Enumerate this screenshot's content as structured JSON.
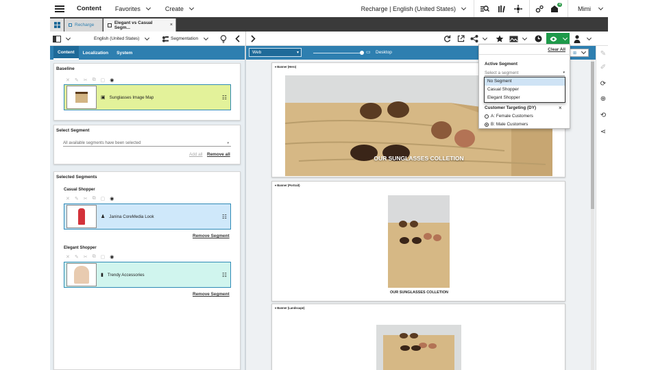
{
  "topbar": {
    "app_title": "Content",
    "favorites": "Favorites",
    "create": "Create",
    "site": "Recharge | English (United States)",
    "user": "Mimi",
    "notifications": "4"
  },
  "tabs": [
    {
      "label": "Recharge"
    },
    {
      "label": "Elegant vs Casual Segm..."
    }
  ],
  "toolbar": {
    "locale": "English (United States)",
    "segmentation": "Segmentation"
  },
  "left_panel": {
    "tabs": [
      "Content",
      "Localization",
      "System"
    ],
    "baseline": {
      "heading": "Baseline",
      "item": "Sunglasses Image Map"
    },
    "select_segment": {
      "heading": "Select Segment",
      "value": "All available segments have been selected",
      "add_all": "Add all",
      "remove_all": "Remove all"
    },
    "selected_segments": {
      "heading": "Selected Segments",
      "segments": [
        {
          "name": "Casual Shopper",
          "item": "Janina CoreMedia Look",
          "remove": "Remove Segment"
        },
        {
          "name": "Elegant Shopper",
          "item": "Trendy Accessories",
          "remove": "Remove Segment"
        }
      ]
    }
  },
  "preview": {
    "channel": "Web",
    "device": "Desktop",
    "banners": [
      {
        "label": "Banner (Hero)",
        "caption": "OUR SUNGLASSES COLLETION"
      },
      {
        "label": "Banner (Portrait)",
        "caption": "OUR SUNGLASSES COLLETION"
      },
      {
        "label": "Banner (Landscape)"
      }
    ]
  },
  "popup": {
    "clear_all": "Clear All",
    "active_segment": "Active Segment",
    "select_placeholder": "Select a segment",
    "options": [
      "No Segment",
      "Casual Shopper",
      "Elegant Shopper"
    ],
    "targeting_title": "Customer Targeting (DY)",
    "radios": [
      {
        "label": "A: Female Customers",
        "checked": false
      },
      {
        "label": "B: Male Customers",
        "checked": true
      }
    ]
  },
  "colors": {
    "accent": "#2e7fb0",
    "baseline_item": "#e3f29a",
    "casual_item": "#cfe8fa",
    "elegant_item": "#d0f5ee",
    "eye_button": "#1e9a4a"
  }
}
